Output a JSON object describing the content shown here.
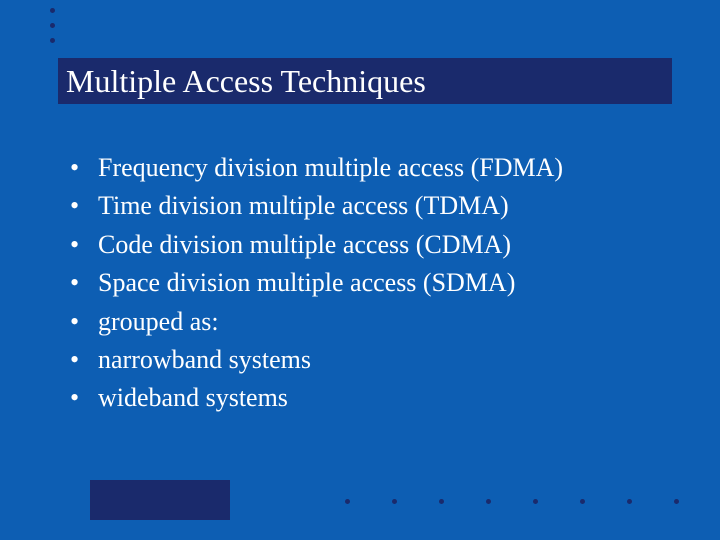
{
  "title": "Multiple Access Techniques",
  "bullets": [
    "Frequency division multiple access (FDMA)",
    "Time division multiple access (TDMA)",
    "Code division multiple access (CDMA)",
    "Space division multiple access (SDMA)",
    "grouped as:",
    "narrowband systems",
    "wideband systems"
  ]
}
